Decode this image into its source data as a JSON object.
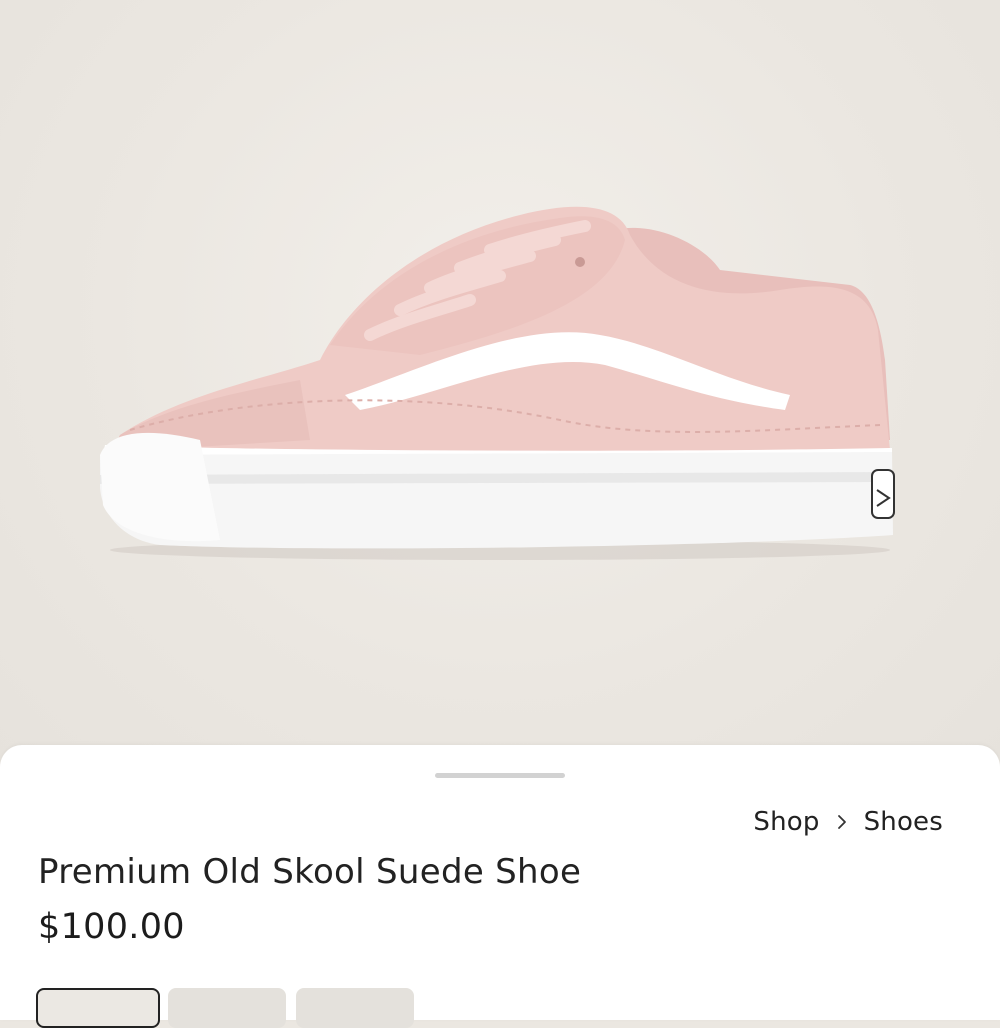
{
  "product": {
    "image_alt": "Pink suede low-top sneaker with white side stripe",
    "colors": {
      "upper": "#eec9c5",
      "stripe": "#ffffff",
      "sole": "#f7f7f7",
      "background": "#ebe7e1"
    }
  },
  "sheet": {
    "breadcrumb": [
      {
        "label": "Shop"
      },
      {
        "label": "Shoes"
      }
    ],
    "breadcrumb_separator_icon": "chevron-right-icon",
    "title": "Premium Old Skool Suede Shoe",
    "price": "$100.00",
    "swatches": [
      {
        "name": "swatch-1",
        "selected": true
      },
      {
        "name": "swatch-2",
        "selected": false
      },
      {
        "name": "swatch-3",
        "selected": false
      }
    ]
  }
}
